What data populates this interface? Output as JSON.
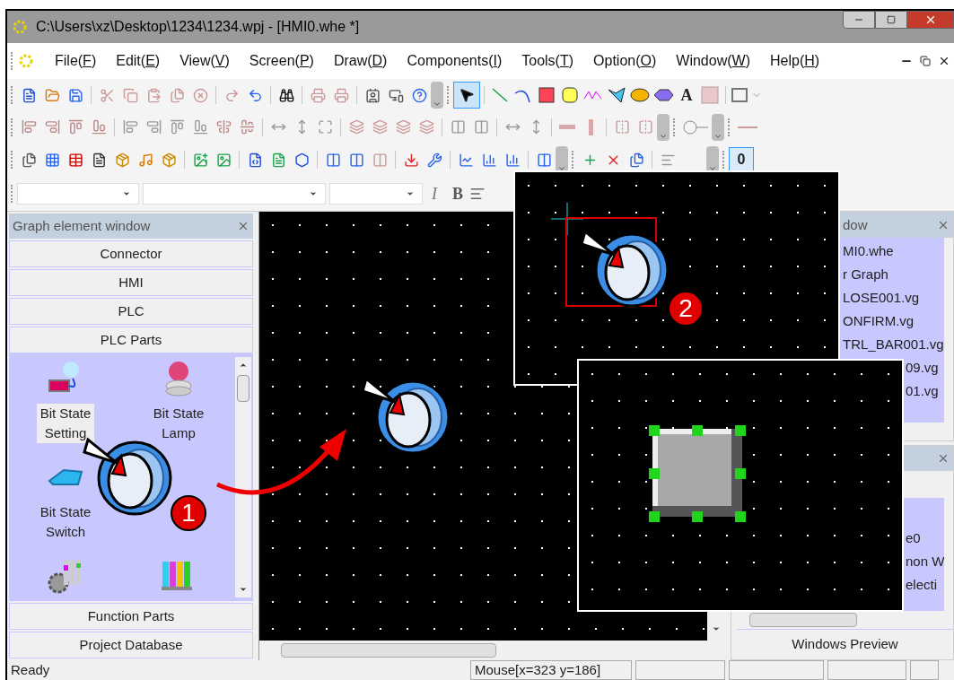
{
  "window": {
    "title": "C:\\Users\\xz\\Desktop\\1234\\1234.wpj - [HMI0.whe *]"
  },
  "menu": [
    {
      "before": "File(",
      "key": "F",
      "after": ")"
    },
    {
      "before": "Edit(",
      "key": "E",
      "after": ")"
    },
    {
      "before": "View(",
      "key": "V",
      "after": ")"
    },
    {
      "before": "Screen(",
      "key": "P",
      "after": ")"
    },
    {
      "before": "Draw(",
      "key": "D",
      "after": ")"
    },
    {
      "before": "Components(",
      "key": "I",
      "after": ")"
    },
    {
      "before": "Tools(",
      "key": "T",
      "after": ")"
    },
    {
      "before": "Option(",
      "key": "O",
      "after": ")"
    },
    {
      "before": "Window(",
      "key": "W",
      "after": ")"
    },
    {
      "before": "Help(",
      "key": "H",
      "after": ")"
    }
  ],
  "toolbar": {
    "text_tool": "A",
    "italic": "I",
    "bold": "B",
    "counter": "0"
  },
  "graph_panel": {
    "title": "Graph element window",
    "sections_top": [
      "Connector",
      "HMI",
      "PLC",
      "PLC Parts"
    ],
    "items": [
      {
        "label": "Bit State Setting",
        "selected": true
      },
      {
        "label": "Bit State Lamp",
        "selected": false
      },
      {
        "label": "Bit State Switch",
        "selected": false
      }
    ],
    "sections_bottom": [
      "Function Parts",
      "Project Database"
    ]
  },
  "file_panel": {
    "title": "dow",
    "items": [
      "MI0.whe",
      "r Graph",
      "LOSE001.vg",
      "ONFIRM.vg",
      "TRL_BAR001.vg",
      "09.vg",
      "01.vg"
    ]
  },
  "property_panel": {
    "items": [
      "e0",
      "non W",
      "electi"
    ]
  },
  "preview_tab": "Windows Preview",
  "steps": [
    "1",
    "2"
  ],
  "status_bar": {
    "message": "Ready",
    "mouse": "Mouse[x=323  y=186]"
  }
}
